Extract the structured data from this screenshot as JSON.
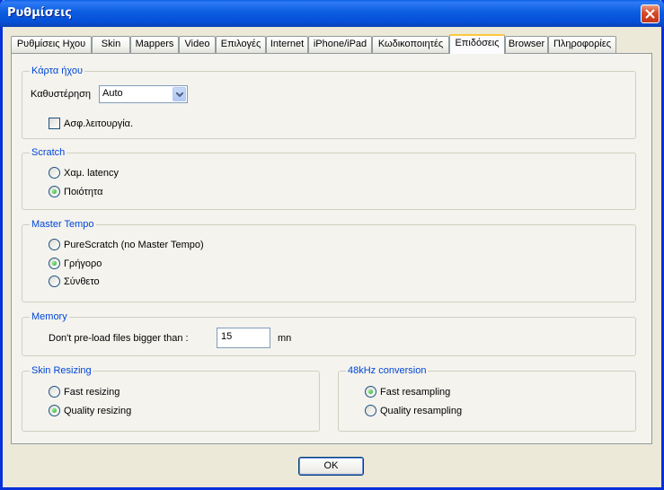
{
  "window": {
    "title": "Ρυθμίσεις"
  },
  "tabs": [
    {
      "label": "Ρυθμίσεις Ηχου",
      "active": false
    },
    {
      "label": "Skin",
      "active": false
    },
    {
      "label": "Mappers",
      "active": false
    },
    {
      "label": "Video",
      "active": false
    },
    {
      "label": "Επιλογές",
      "active": false
    },
    {
      "label": "Internet",
      "active": false
    },
    {
      "label": "iPhone/iPad",
      "active": false
    },
    {
      "label": "Κωδικοποιητές",
      "active": false
    },
    {
      "label": "Επιδόσεις",
      "active": true
    },
    {
      "label": "Browser",
      "active": false
    },
    {
      "label": "Πληροφορίες",
      "active": false
    }
  ],
  "sound_card": {
    "legend": "Κάρτα ήχου",
    "latency_label": "Καθυστέρηση",
    "latency_value": "Auto",
    "safe_mode_label": "Ασφ.λειτουργία.",
    "safe_mode_checked": false
  },
  "scratch": {
    "legend": "Scratch",
    "options": [
      {
        "label": "Χαμ. latency",
        "selected": false
      },
      {
        "label": "Ποιότητα",
        "selected": true
      }
    ]
  },
  "master_tempo": {
    "legend": "Master Tempo",
    "options": [
      {
        "label": "PureScratch (no Master Tempo)",
        "selected": false
      },
      {
        "label": "Γρήγορο",
        "selected": true
      },
      {
        "label": "Σύνθετο",
        "selected": false
      }
    ]
  },
  "memory": {
    "legend": "Memory",
    "label": "Don't pre-load files bigger than :",
    "value": "15",
    "unit": "mn"
  },
  "skin_resizing": {
    "legend": "Skin Resizing",
    "options": [
      {
        "label": "Fast resizing",
        "selected": false
      },
      {
        "label": "Quality resizing",
        "selected": true
      }
    ]
  },
  "conversion_48k": {
    "legend": "48kHz conversion",
    "options": [
      {
        "label": "Fast resampling",
        "selected": true
      },
      {
        "label": "Quality resampling",
        "selected": false
      }
    ]
  },
  "ok_label": "OK",
  "colors": {
    "titlebar": "#0a5fe6",
    "legend_text": "#0046d5",
    "tab_highlight": "#ffc83c",
    "panel_bg": "#f4f3ee"
  }
}
